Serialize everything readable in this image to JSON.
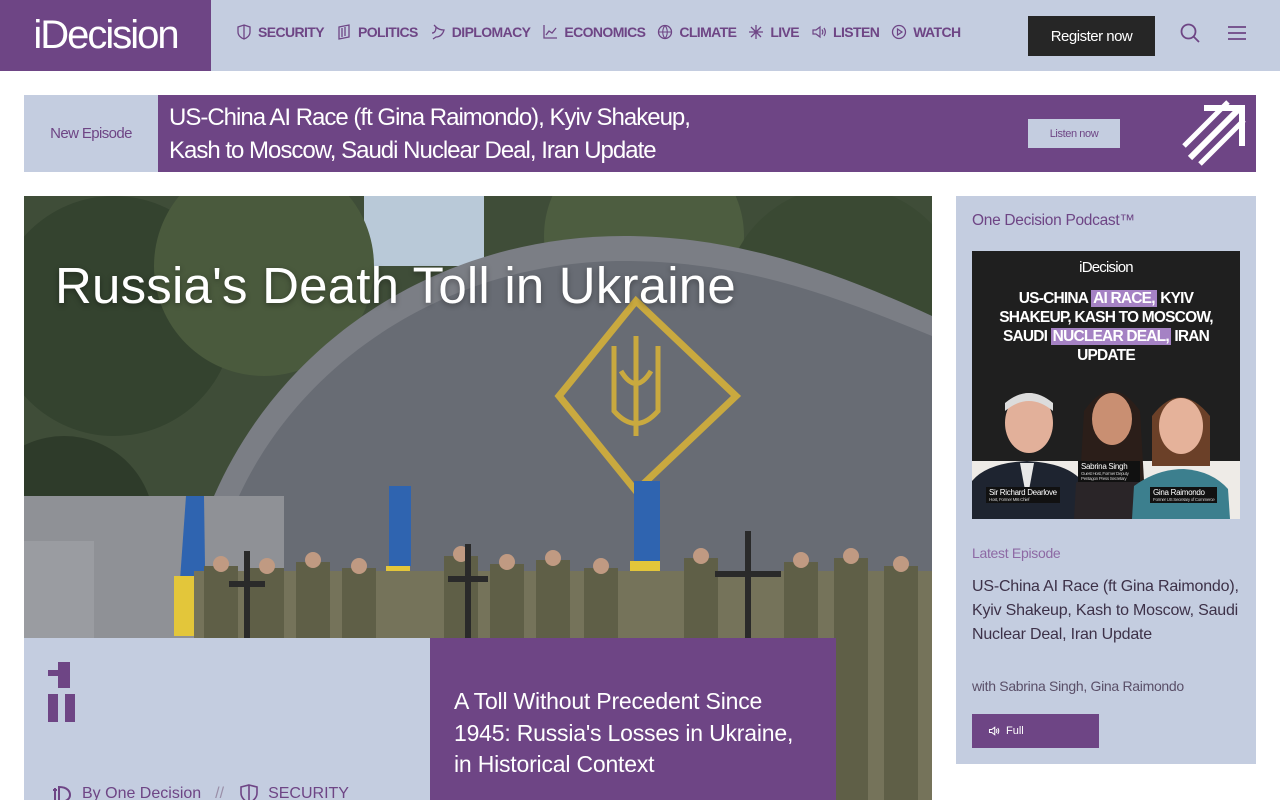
{
  "header": {
    "logo": "iDecision",
    "nav": [
      {
        "label": "SECURITY",
        "icon": "shield-icon"
      },
      {
        "label": "POLITICS",
        "icon": "columns-icon"
      },
      {
        "label": "DIPLOMACY",
        "icon": "dove-icon"
      },
      {
        "label": "ECONOMICS",
        "icon": "chart-icon"
      },
      {
        "label": "CLIMATE",
        "icon": "globe-icon"
      },
      {
        "label": "LIVE",
        "icon": "asterisk-icon"
      },
      {
        "label": "LISTEN",
        "icon": "speaker-icon"
      },
      {
        "label": "WATCH",
        "icon": "play-icon"
      }
    ],
    "register": "Register now"
  },
  "banner": {
    "tag": "New Episode",
    "title_line1": "US-China AI Race (ft Gina Raimondo), Kyiv Shakeup,",
    "title_line2": "Kash to Moscow, Saudi Nuclear Deal, Iran Update",
    "button": "Listen now"
  },
  "hero": {
    "title": "Russia's Death Toll in Ukraine",
    "author": "By One Decision",
    "separator": "//",
    "category": "SECURITY",
    "article_title": "A Toll Without Precedent Since 1945: Russia's Losses in Ukraine, in Historical Context"
  },
  "sidebar": {
    "title": "One Decision Podcast™",
    "cover": {
      "logo": "iDecision",
      "headline": {
        "part1": "US-CHINA ",
        "hl1": "AI RACE,",
        "part2": " KYIV SHAKEUP, KASH TO MOSCOW, SAUDI ",
        "hl2": "NUCLEAR DEAL,",
        "part3": " IRAN UPDATE"
      },
      "people": [
        {
          "name": "Sir Richard Dearlove",
          "role": "Host, Former MI6 Chief"
        },
        {
          "name": "Sabrina Singh",
          "role": "Guest Host, Former Deputy Pentagon Press Secretary"
        },
        {
          "name": "Gina Raimondo",
          "role": "Former US Secretary of Commerce"
        }
      ]
    },
    "latest_label": "Latest Episode",
    "latest_title": "US-China AI Race (ft Gina Raimondo), Kyiv Shakeup, Kash to Moscow, Saudi Nuclear Deal, Iran Update",
    "latest_with": "with Sabrina Singh, Gina Raimondo",
    "full_button": "Full"
  },
  "colors": {
    "brand_purple": "#6e4585",
    "light_blue_grey": "#c4cde0",
    "dark_button": "#262626"
  }
}
